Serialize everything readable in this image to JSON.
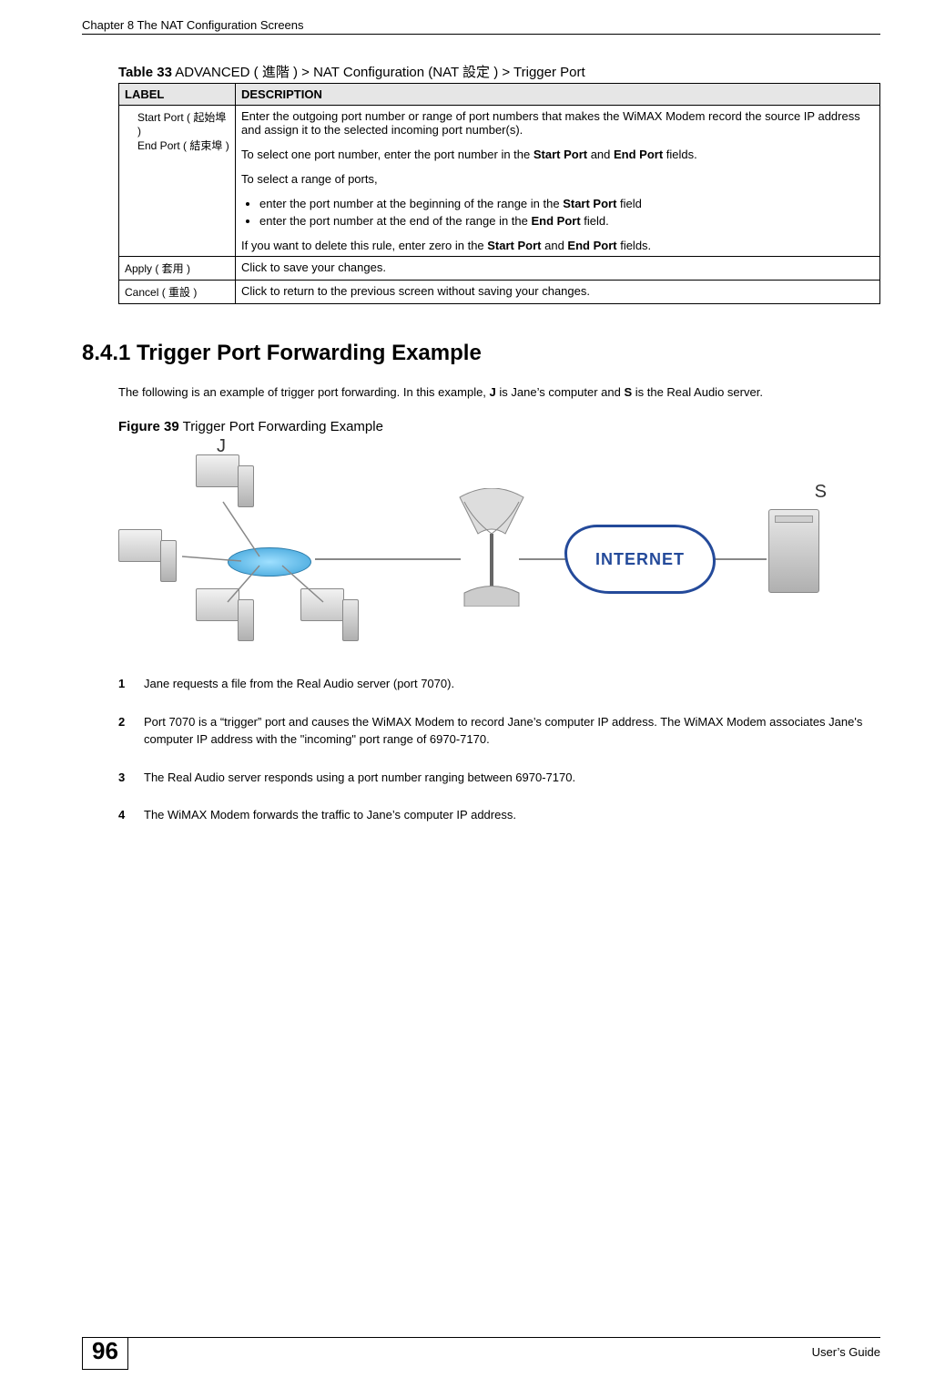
{
  "header": {
    "chapter_line": "Chapter 8 The NAT Configuration Screens"
  },
  "table": {
    "caption_prefix": "Table 33",
    "caption_rest": "   ADVANCED ( 進階 ) > NAT Configuration (NAT 設定 )  > Trigger Port",
    "head_label": "LABEL",
    "head_desc": "DESCRIPTION",
    "rows": [
      {
        "label_line1": "Start Port ( 起始埠 )",
        "label_line2": "End Port ( 結束埠 )",
        "desc_p1": "Enter the outgoing port number or range of port numbers that makes the WiMAX Modem record the source IP address and assign it to the selected incoming port number(s).",
        "desc_p2_a": "To select one port number, enter the port number in the ",
        "desc_p2_b1": "Start Port",
        "desc_p2_c": " and ",
        "desc_p2_b2": "End Port",
        "desc_p2_d": " fields.",
        "desc_p3": "To select a range of ports,",
        "desc_li1_a": "enter the port number at the beginning of the range in the ",
        "desc_li1_b": "Start Port",
        "desc_li1_c": " field",
        "desc_li2_a": "enter the port number at the end of the range in the ",
        "desc_li2_b": "End Port",
        "desc_li2_c": " field.",
        "desc_p4_a": "If you want to delete this rule, enter zero in the ",
        "desc_p4_b1": "Start Port",
        "desc_p4_c": " and ",
        "desc_p4_b2": "End Port",
        "desc_p4_d": " fields."
      },
      {
        "label": "Apply ( 套用 )",
        "desc": "Click to save your changes."
      },
      {
        "label": "Cancel ( 重設 )",
        "desc": "Click to return to the previous screen without saving your changes."
      }
    ]
  },
  "section": {
    "heading": "8.4.1  Trigger Port Forwarding Example",
    "intro_a": "The following is an example of trigger port forwarding. In this example, ",
    "intro_b1": "J",
    "intro_c": " is Jane’s computer and ",
    "intro_b2": "S",
    "intro_d": " is the Real Audio server.",
    "fig_caption_prefix": "Figure 39",
    "fig_caption_rest": "   Trigger Port Forwarding Example",
    "fig_label_j": "J",
    "fig_label_s": "S",
    "fig_internet": "INTERNET",
    "steps": [
      "Jane requests a file from the Real Audio server (port 7070).",
      "Port 7070 is a “trigger” port and causes the WiMAX Modem to record Jane’s computer IP address. The WiMAX Modem associates Jane's computer IP address with the \"incoming\" port range of 6970-7170.",
      "The Real Audio server responds using a port number ranging between 6970-7170.",
      "The WiMAX Modem forwards the traffic to Jane’s computer IP address."
    ]
  },
  "footer": {
    "page_number": "96",
    "guide": "User’s Guide"
  }
}
